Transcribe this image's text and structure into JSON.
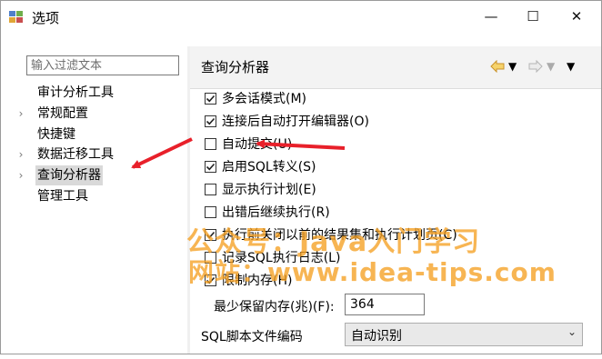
{
  "window": {
    "title": "选项",
    "controls": {
      "minimize": "—",
      "maximize": "☐",
      "close": "✕"
    }
  },
  "sidebar": {
    "filter_placeholder": "输入过滤文本",
    "items": [
      {
        "label": "审计分析工具",
        "expandable": false
      },
      {
        "label": "常规配置",
        "expandable": true
      },
      {
        "label": "快捷键",
        "expandable": false
      },
      {
        "label": "数据迁移工具",
        "expandable": true
      },
      {
        "label": "查询分析器",
        "expandable": true,
        "selected": true
      },
      {
        "label": "管理工具",
        "expandable": false
      }
    ]
  },
  "page": {
    "title": "查询分析器",
    "nav": {
      "back_icon": "arrow-left-icon",
      "forward_icon": "arrow-right-icon",
      "menu_icon": "chevron-down-icon"
    }
  },
  "options": [
    {
      "label": "多会话模式(M)",
      "checked": true
    },
    {
      "label": "连接后自动打开编辑器(O)",
      "checked": true
    },
    {
      "label": "自动提交(U)",
      "checked": false
    },
    {
      "label": "启用SQL转义(S)",
      "checked": true
    },
    {
      "label": "显示执行计划(E)",
      "checked": false
    },
    {
      "label": "出错后继续执行(R)",
      "checked": false
    },
    {
      "label": "执行前关闭以前的结果集和执行计划页(C)",
      "checked": true
    },
    {
      "label": "记录SQL执行日志(L)",
      "checked": false
    },
    {
      "label": "限制内存(H)",
      "checked": true
    }
  ],
  "retain_memory": {
    "label": "最少保留内存(兆)(F):",
    "value": "364"
  },
  "encoding": {
    "label": "SQL脚本文件编码",
    "value": "自动识别"
  },
  "watermark": {
    "line1": "公众号：Java入门学习",
    "line2": "网站：www.idea-tips.com"
  },
  "colors": {
    "annotation_arrow": "#e8202a",
    "watermark": "#f5a023",
    "selection": "#d9d9d9"
  }
}
